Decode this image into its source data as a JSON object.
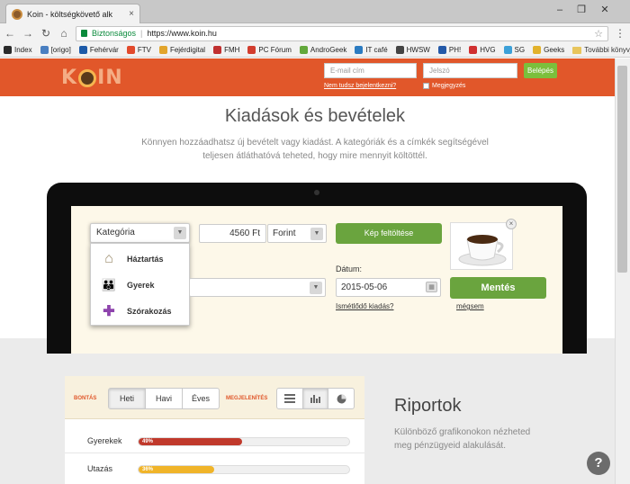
{
  "browser": {
    "tab_title": "Koin - költségkövető alk",
    "tab_close": "×",
    "secure_label": "Biztonságos",
    "url": "https://www.koin.hu",
    "window_buttons": [
      "‒",
      "❐",
      "✕"
    ],
    "nav": [
      "←",
      "→",
      "↻",
      "⌂"
    ],
    "bookmarks": [
      {
        "label": "Index",
        "color": "#2a2a2a"
      },
      {
        "label": "[origo]",
        "color": "#4a7fc1"
      },
      {
        "label": "Fehérvár",
        "color": "#1d5aa8"
      },
      {
        "label": "FTV",
        "color": "#e24a2c"
      },
      {
        "label": "Fejérdigital",
        "color": "#e2a52c"
      },
      {
        "label": "FMH",
        "color": "#c03030"
      },
      {
        "label": "PC Fórum",
        "color": "#d23d2e"
      },
      {
        "label": "AndroGeek",
        "color": "#63a83c"
      },
      {
        "label": "IT café",
        "color": "#2b7bc1"
      },
      {
        "label": "HWSW",
        "color": "#444444"
      },
      {
        "label": "PH!",
        "color": "#2459a8"
      },
      {
        "label": "HVG",
        "color": "#d03030"
      },
      {
        "label": "SG",
        "color": "#3ca0d8"
      },
      {
        "label": "Geeks",
        "color": "#e2b22c"
      }
    ],
    "bookmarks_more": "További könyvjelzők"
  },
  "header": {
    "logo": {
      "k": "K",
      "rest": "IN"
    },
    "email_placeholder": "E-mail cím",
    "password_placeholder": "Jelszó",
    "login_label": "Belépés",
    "forgot_label": "Nem tudsz bejelentkezni?",
    "remember_label": "Megjegyzés",
    "accent_color": "#e1572a"
  },
  "hero": {
    "title": "Kiadások és bevételek",
    "subtitle_line1": "Könnyen hozzáadhatsz új bevételt vagy kiadást. A kategóriák és a címkék segítségével",
    "subtitle_line2": "teljesen átláthatóvá teheted, hogy mire mennyit költöttél."
  },
  "form": {
    "category_placeholder": "Kategória",
    "dropdown_arrow": "▼",
    "categories": [
      {
        "label": "Háztartás",
        "icon": "house-icon",
        "glyph": "⌂",
        "color": "#9a8a6a"
      },
      {
        "label": "Gyerek",
        "icon": "children-icon",
        "glyph": "👪",
        "color": "#c0392b"
      },
      {
        "label": "Szórakozás",
        "icon": "puzzle-icon",
        "glyph": "✚",
        "color": "#8e44ad"
      }
    ],
    "amount": "4560 Ft",
    "currency": "Forint",
    "date_label": "Dátum:",
    "date_value": "2015-05-06",
    "calendar_glyph": "▦",
    "recurring_label": "Ismétlődő kiadás?",
    "photo_upload_label": "Kép feltöltése",
    "photo_close": "×",
    "save_label": "Mentés",
    "cancel_label": "mégsem",
    "primary_green": "#6aa43e"
  },
  "reports": {
    "breakdown_label": "BONTÁS",
    "periods": [
      "Heti",
      "Havi",
      "Éves"
    ],
    "period_selected": "Heti",
    "display_label": "MEGJELENÍTÉS",
    "views": [
      "list-view-icon",
      "bar-chart-icon",
      "pie-chart-icon"
    ],
    "rows": [
      {
        "label": "Gyerekek",
        "percent_label": "49%",
        "value": 49,
        "color": "#c0392b"
      },
      {
        "label": "Utazás",
        "percent_label": "36%",
        "value": 36,
        "color": "#f0b429"
      }
    ],
    "title": "Riportok",
    "desc_line1": "Különböző grafikonokon nézheted",
    "desc_line2": "meg pénzügyeid alakulását."
  },
  "help_label": "?"
}
